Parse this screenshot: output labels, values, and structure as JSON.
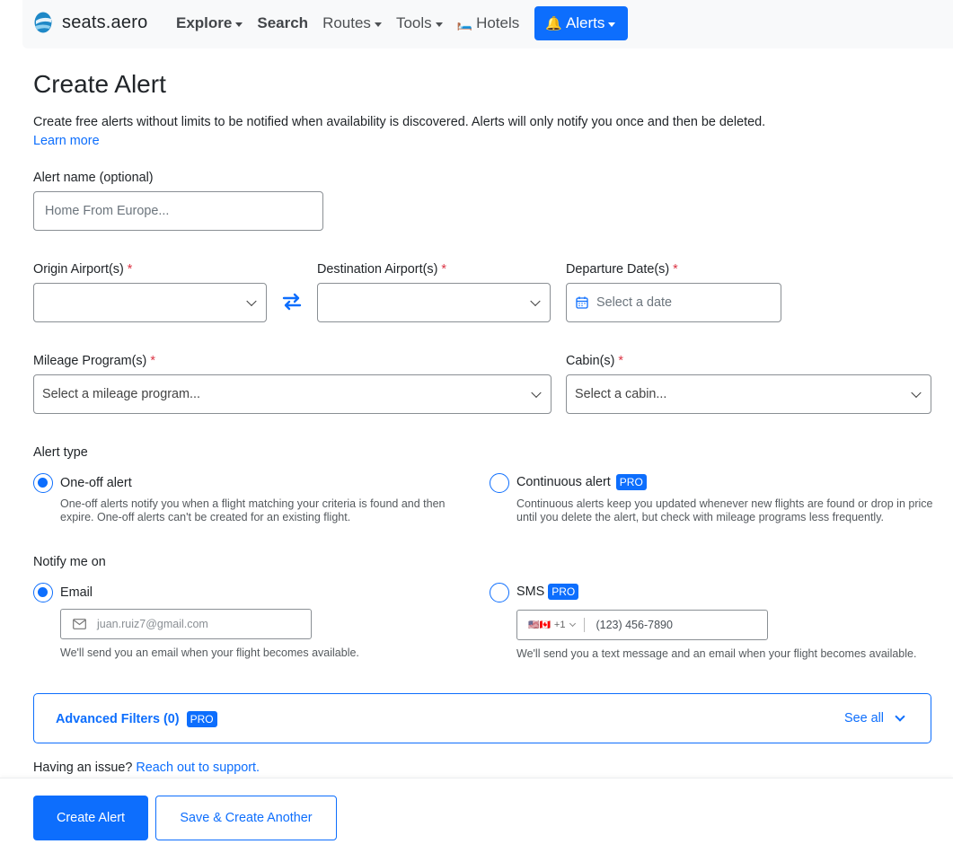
{
  "nav": {
    "brand": "seats.aero",
    "items": [
      {
        "label": "Explore",
        "dropdown": true,
        "bold": true
      },
      {
        "label": "Search",
        "dropdown": false,
        "bold": true
      },
      {
        "label": "Routes",
        "dropdown": true,
        "bold": false
      },
      {
        "label": "Tools",
        "dropdown": true,
        "bold": false
      },
      {
        "label": "Hotels",
        "dropdown": false,
        "bold": false,
        "icon": "🛏️"
      }
    ],
    "alerts": {
      "label": "Alerts",
      "icon": "🔔"
    }
  },
  "page": {
    "title": "Create Alert",
    "intro": "Create free alerts without limits to be notified when availability is discovered. Alerts will only notify you once and then be deleted.",
    "learn_more": "Learn more"
  },
  "form": {
    "alert_name": {
      "label": "Alert name (optional)",
      "placeholder": "Home From Europe..."
    },
    "origin": {
      "label": "Origin Airport(s)",
      "required": "*",
      "value": ""
    },
    "destination": {
      "label": "Destination Airport(s)",
      "required": "*",
      "value": ""
    },
    "departure": {
      "label": "Departure Date(s)",
      "required": "*",
      "placeholder": "Select a date"
    },
    "mileage": {
      "label": "Mileage Program(s)",
      "required": "*",
      "placeholder": "Select a mileage program..."
    },
    "cabin": {
      "label": "Cabin(s)",
      "required": "*",
      "placeholder": "Select a cabin..."
    },
    "alert_type": {
      "label": "Alert type",
      "one_off": {
        "label": "One-off alert",
        "checked": true,
        "help": "One-off alerts notify you when a flight matching your criteria is found and then expire. One-off alerts can't be created for an existing flight."
      },
      "continuous": {
        "label": "Continuous alert",
        "badge": "PRO",
        "checked": false,
        "help": "Continuous alerts keep you updated whenever new flights are found or drop in price until you delete the alert, but check with mileage programs less frequently."
      }
    },
    "notify": {
      "label": "Notify me on",
      "email": {
        "label": "Email",
        "checked": true,
        "placeholder": "juan.ruiz7@gmail.com",
        "help": "We'll send you an email when your flight becomes available."
      },
      "sms": {
        "label": "SMS",
        "badge": "PRO",
        "checked": false,
        "country_code": "+1",
        "flags": "🇺🇸🇨🇦",
        "placeholder": "(123) 456-7890",
        "help": "We'll send you a text message and an email when your flight becomes available."
      }
    },
    "advanced": {
      "label": "Advanced Filters (0)",
      "badge": "PRO",
      "see_all": "See all"
    }
  },
  "support": {
    "text": "Having an issue?",
    "link": "Reach out to support."
  },
  "footer": {
    "create": "Create Alert",
    "save_another": "Save & Create Another"
  },
  "colors": {
    "accent": "#0d6efd",
    "required": "#dc3545"
  }
}
